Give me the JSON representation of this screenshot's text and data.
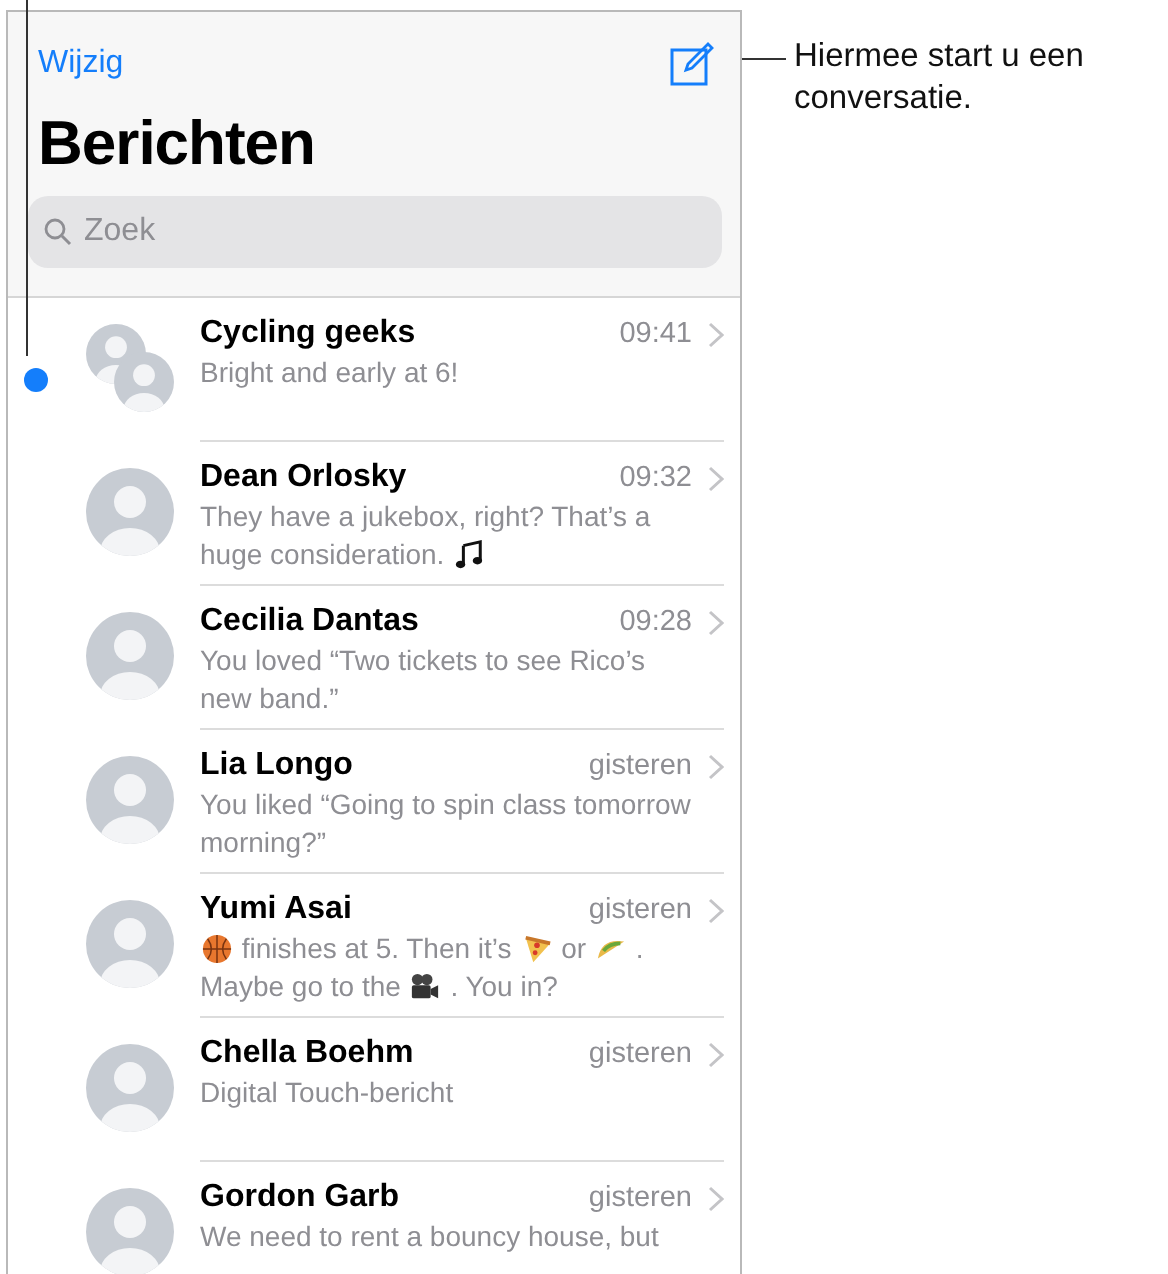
{
  "nav": {
    "edit": "Wijzig"
  },
  "title": "Berichten",
  "search": {
    "placeholder": "Zoek"
  },
  "callout": {
    "text": "Hiermee start u een conversatie."
  },
  "conversations": [
    {
      "name": "Cycling geeks",
      "time": "09:41",
      "unread": true,
      "group": true,
      "message": [
        {
          "kind": "text",
          "text": "Bright and early at 6!"
        }
      ]
    },
    {
      "name": "Dean Orlosky",
      "time": "09:32",
      "unread": false,
      "group": false,
      "message": [
        {
          "kind": "text",
          "text": "They have a jukebox, right? That’s a huge consideration."
        },
        {
          "kind": "music"
        }
      ]
    },
    {
      "name": "Cecilia Dantas",
      "time": "09:28",
      "unread": false,
      "group": false,
      "message": [
        {
          "kind": "text",
          "text": "You loved “Two tickets to see Rico’s new band.”"
        }
      ]
    },
    {
      "name": "Lia Longo",
      "time": "gisteren",
      "unread": false,
      "group": false,
      "message": [
        {
          "kind": "text",
          "text": "You liked “Going to spin class tomorrow morning?”"
        }
      ]
    },
    {
      "name": "Yumi Asai",
      "time": "gisteren",
      "unread": false,
      "group": false,
      "message": [
        {
          "kind": "basketball"
        },
        {
          "kind": "text",
          "text": "finishes at 5. Then it’s"
        },
        {
          "kind": "pizza"
        },
        {
          "kind": "text",
          "text": "or"
        },
        {
          "kind": "taco"
        },
        {
          "kind": "text",
          "text": ". Maybe go to the"
        },
        {
          "kind": "camera"
        },
        {
          "kind": "text",
          "text": ". You in?"
        }
      ]
    },
    {
      "name": "Chella Boehm",
      "time": "gisteren",
      "unread": false,
      "group": false,
      "message": [
        {
          "kind": "text",
          "text": "Digital Touch-bericht"
        }
      ]
    },
    {
      "name": "Gordon Garb",
      "time": "gisteren",
      "unread": false,
      "group": false,
      "message": [
        {
          "kind": "text",
          "text": "We need to rent a bouncy house, but"
        }
      ]
    }
  ]
}
